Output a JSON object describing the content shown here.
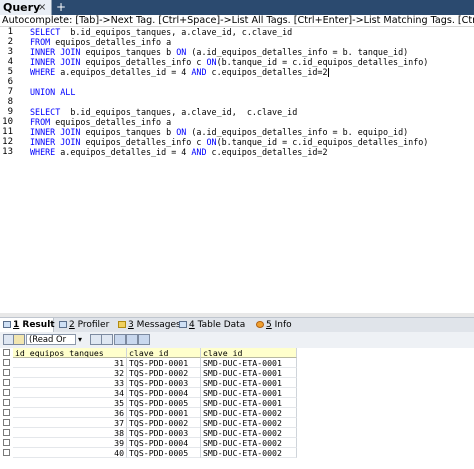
{
  "query_tab": {
    "label": "Query",
    "close": "×",
    "add": "+"
  },
  "autocomplete": "Autocomplete: [Tab]->Next Tag. [Ctrl+Space]->List All Tags. [Ctrl+Enter]->List Matching Tags. [Ctrl+Shift+Space]->List All Functions.",
  "editor": {
    "line_numbers": [
      "1",
      "2",
      "3",
      "4",
      "5",
      "6",
      "7",
      "8",
      "9",
      "10",
      "11",
      "12",
      "13"
    ],
    "lines": [
      [
        {
          "t": "SELECT",
          "k": true
        },
        {
          "t": "  b.id_equipos_tanques, a.clave_id, c.clave_id"
        }
      ],
      [
        {
          "t": "FROM",
          "k": true
        },
        {
          "t": " equipos_detalles_info a"
        }
      ],
      [
        {
          "t": "INNER JOIN",
          "k": true
        },
        {
          "t": " equipos_tanques b "
        },
        {
          "t": "ON",
          "k": true
        },
        {
          "t": " (a.id_equipos_detalles_info = b. tanque_id)"
        }
      ],
      [
        {
          "t": "INNER JOIN",
          "k": true
        },
        {
          "t": " equipos_detalles_info c "
        },
        {
          "t": "ON",
          "k": true
        },
        {
          "t": "(b.tanque_id = c.id_equipos_detalles_info)"
        }
      ],
      [
        {
          "t": "WHERE",
          "k": true
        },
        {
          "t": " a.equipos_detalles_id = 4 "
        },
        {
          "t": "AND",
          "k": true
        },
        {
          "t": " c.equipos_detalles_id=2"
        }
      ],
      [],
      [
        {
          "t": "UNION ALL",
          "k": true
        }
      ],
      [],
      [
        {
          "t": "SELECT",
          "k": true
        },
        {
          "t": "  b.id_equipos_tanques, a.clave_id,  c.clave_id"
        }
      ],
      [
        {
          "t": "FROM",
          "k": true
        },
        {
          "t": " equipos_detalles_info a"
        }
      ],
      [
        {
          "t": "INNER JOIN",
          "k": true
        },
        {
          "t": " equipos_tanques b "
        },
        {
          "t": "ON",
          "k": true
        },
        {
          "t": " (a.id_equipos_detalles_info = b. equipo_id)"
        }
      ],
      [
        {
          "t": "INNER JOIN",
          "k": true
        },
        {
          "t": " equipos_detalles_info c "
        },
        {
          "t": "ON",
          "k": true
        },
        {
          "t": "(b.tanque_id = c.id_equipos_detalles_info)"
        }
      ],
      [
        {
          "t": "WHERE",
          "k": true
        },
        {
          "t": " a.equipos_detalles_id = 4 "
        },
        {
          "t": "AND",
          "k": true
        },
        {
          "t": " c.equipos_detalles_id=2"
        }
      ]
    ]
  },
  "result_tabs": [
    {
      "num": "1",
      "label": " Result",
      "active": true,
      "icon": "table-icon"
    },
    {
      "num": "2",
      "label": " Profiler",
      "active": false,
      "icon": "profiler-icon"
    },
    {
      "num": "3",
      "label": " Messages",
      "active": false,
      "icon": "messages-icon"
    },
    {
      "num": "4",
      "label": " Table Data",
      "active": false,
      "icon": "table-data-icon"
    },
    {
      "num": "5",
      "label": " Info",
      "active": false,
      "icon": "info-icon"
    }
  ],
  "toolbar": {
    "mode": "(Read Or"
  },
  "grid": {
    "columns": [
      "id_equipos_tanques",
      "clave_id",
      "clave_id"
    ],
    "rows": [
      [
        "31",
        "TQS-PDD-0001",
        "SMD-DUC-ETA-0001"
      ],
      [
        "32",
        "TQS-PDD-0002",
        "SMD-DUC-ETA-0001"
      ],
      [
        "33",
        "TQS-PDD-0003",
        "SMD-DUC-ETA-0001"
      ],
      [
        "34",
        "TQS-PDD-0004",
        "SMD-DUC-ETA-0001"
      ],
      [
        "35",
        "TQS-PDD-0005",
        "SMD-DUC-ETA-0001"
      ],
      [
        "36",
        "TQS-PDD-0001",
        "SMD-DUC-ETA-0002"
      ],
      [
        "37",
        "TQS-PDD-0002",
        "SMD-DUC-ETA-0002"
      ],
      [
        "38",
        "TQS-PDD-0003",
        "SMD-DUC-ETA-0002"
      ],
      [
        "39",
        "TQS-PDD-0004",
        "SMD-DUC-ETA-0002"
      ],
      [
        "40",
        "TQS-PDD-0005",
        "SMD-DUC-ETA-0002"
      ]
    ]
  },
  "colors": {
    "tabbar": "#2b4a6f",
    "keyword": "#0000ff",
    "header_bg": "#ffffcc"
  }
}
